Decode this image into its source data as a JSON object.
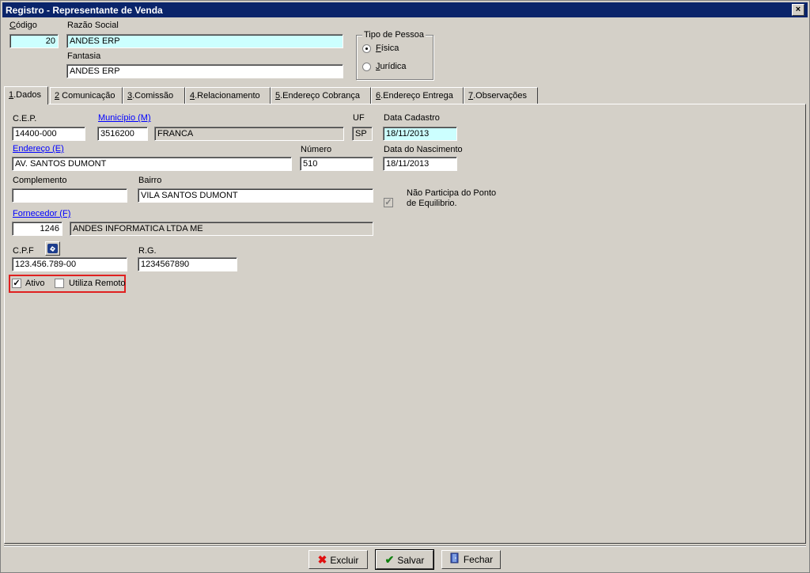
{
  "window": {
    "title": "Registro - Representante de Venda",
    "close": "×"
  },
  "header": {
    "codigo_label": "Código",
    "codigo_value": "20",
    "razao_label": "Razão Social",
    "razao_value": "ANDES ERP",
    "fantasia_label": "Fantasia",
    "fantasia_value": "ANDES ERP",
    "tipo_pessoa": {
      "title": "Tipo de Pessoa",
      "fisica": "Física",
      "juridica": "Jurídica",
      "selected": "Física"
    }
  },
  "tabs": [
    {
      "num": "1",
      "label": ".Dados"
    },
    {
      "num": "2",
      "label": " Comunicação"
    },
    {
      "num": "3",
      "label": ".Comissão"
    },
    {
      "num": "4",
      "label": ".Relacionamento"
    },
    {
      "num": "5",
      "label": ".Endereço Cobrança"
    },
    {
      "num": "6",
      "label": ".Endereço Entrega"
    },
    {
      "num": "7",
      "label": ".Observações"
    }
  ],
  "dados": {
    "cep_label": "C.E.P.",
    "cep_value": "14400-000",
    "municipio_label": "Município (M)",
    "municipio_code": "3516200",
    "municipio_name": "FRANCA",
    "uf_label": "UF",
    "uf_value": "SP",
    "data_cadastro_label": "Data Cadastro",
    "data_cadastro_value": "18/11/2013",
    "endereco_label": "Endereço (E)",
    "endereco_value": "AV. SANTOS DUMONT",
    "numero_label": "Número",
    "numero_value": "510",
    "nascimento_label": "Data do Nascimento",
    "nascimento_value": "18/11/2013",
    "complemento_label": "Complemento",
    "complemento_value": "",
    "bairro_label": "Bairro",
    "bairro_value": "VILA SANTOS DUMONT",
    "ponto_line1": "Não Participa do Ponto",
    "ponto_line2": "de Equilibrio.",
    "fornecedor_label": "Fornecedor (F)",
    "fornecedor_code": "1246",
    "fornecedor_name": "ANDES INFORMATICA LTDA ME",
    "cpf_label": "C.P.F",
    "cpf_value": "123.456.789-00",
    "rg_label": "R.G.",
    "rg_value": "1234567890",
    "ativo_label": "Ativo",
    "ativo_checked": true,
    "remoto_label": "Utiliza Remoto",
    "remoto_checked": false
  },
  "footer": {
    "excluir": "Excluir",
    "salvar": "Salvar",
    "fechar": "Fechar"
  },
  "colors": {
    "title_bg": "#0a246a",
    "highlight_field": "#ccffff",
    "link": "#0000ff",
    "red_frame": "#e02020"
  }
}
